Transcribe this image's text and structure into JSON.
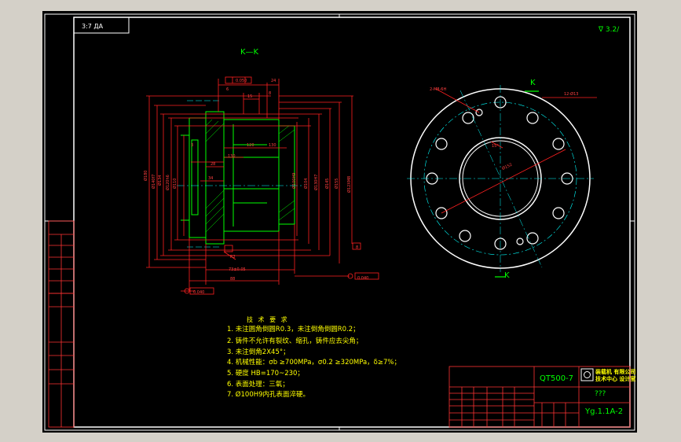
{
  "view": {
    "section_title": "K—K",
    "section_mark_top": "K",
    "section_mark_bottom": "K"
  },
  "roughness_symbol": "∇ 3.2/",
  "top_box_text": "3:7 ДА",
  "tech_notes": {
    "title": "技 术 要 求",
    "items": [
      "1. 未注圆角倒圆R0.3，未注倒角倒圆R0.2；",
      "2. 铸件不允许有裂纹、缩孔，铸件应去尖角；",
      "3. 未注倒角2X45°；",
      "4. 机械性能：σb ≥700MPa，σ0.2 ≥320MPa，δ≥7%；",
      "5. 硬度 HB=170~230；",
      "6. 表面处理：三氧；",
      "7. Ø100H9内孔表面淬硬。"
    ]
  },
  "title_block": {
    "material": "QT500-7",
    "company_line1": "装载机 有限公司",
    "company_line2": "技术中心 设计室",
    "unknown_field": "???",
    "drawing_number": "Yg.1.1A-2"
  },
  "colors": {
    "sheet_background": "#000000",
    "outer_frame": "#ffffff",
    "dimension_red": "#ff0000",
    "outline_green": "#00ff00",
    "text_yellow": "#ffff00",
    "center_cyan": "#00ffff",
    "window_gray": "#d4d0c8"
  }
}
